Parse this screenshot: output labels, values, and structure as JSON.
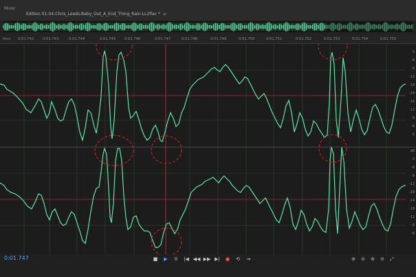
{
  "panel": {
    "mixer_label": "Mixer"
  },
  "file": {
    "tab_label": "Edition 01-04-Chris_Leeds-Baby_Out_A_End_Thing_Rain-LL2flac *",
    "close_symbol": "≡"
  },
  "ruler": {
    "unit_label": "hms",
    "ticks": [
      "0:01.742",
      "0:01.743",
      "0:01.744",
      "0:01.745",
      "0:01.746",
      "0:01.747",
      "0:01.748",
      "0:01.749",
      "0:01.750",
      "0:01.751",
      "0:01.752",
      "0:01.753",
      "0:01.754",
      "0:01.755"
    ]
  },
  "scale_top": [
    "-3",
    "-6",
    "-9",
    "-12",
    "-18",
    "-24",
    "-18",
    "-12",
    "-9",
    "-6",
    "-3"
  ],
  "scale_bottom": [
    "dB",
    "-3",
    "-6",
    "-9",
    "-12",
    "-18",
    "-24",
    "-18",
    "-12",
    "-9",
    "-6"
  ],
  "bottom": {
    "time": "0:01.747",
    "transport": [
      {
        "name": "stop",
        "glyph": "■"
      },
      {
        "name": "play",
        "glyph": "▶"
      },
      {
        "name": "pause",
        "glyph": "II"
      },
      {
        "name": "to-start",
        "glyph": "|◀"
      },
      {
        "name": "rewind",
        "glyph": "◀◀"
      },
      {
        "name": "fast-forward",
        "glyph": "▶▶"
      },
      {
        "name": "to-end",
        "glyph": "▶|"
      },
      {
        "name": "record",
        "glyph": "●"
      },
      {
        "name": "loop",
        "glyph": "⟲"
      },
      {
        "name": "skip",
        "glyph": "⇥"
      }
    ],
    "zoom": [
      {
        "name": "zoom-in-amplitude",
        "glyph": "⊕"
      },
      {
        "name": "zoom-out-amplitude",
        "glyph": "⊖"
      },
      {
        "name": "zoom-in-time",
        "glyph": "⊕"
      },
      {
        "name": "zoom-out-time",
        "glyph": "⊖"
      },
      {
        "name": "zoom-full",
        "glyph": "⤢"
      }
    ]
  },
  "colors": {
    "wave": "#5ce8a6",
    "grid": "#2c4d2e",
    "playhead": "#d23232",
    "highlight": "#d21f1f",
    "accent": "#4aa7ff"
  }
}
